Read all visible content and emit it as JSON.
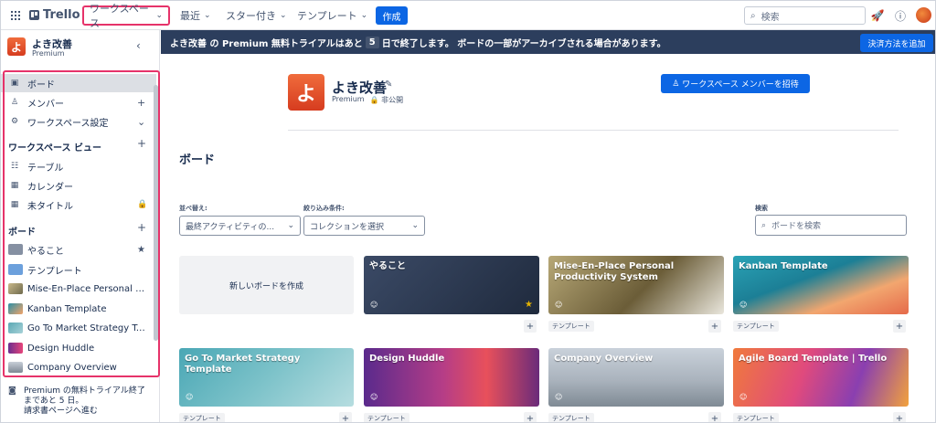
{
  "topbar": {
    "logo_text": "Trello",
    "workspaces_label": "ワークスペース",
    "recent_label": "最近",
    "starred_label": "スター付き",
    "templates_label": "テンプレート",
    "create_label": "作成",
    "search_placeholder": "検索"
  },
  "sidebar": {
    "workspace_name": "よき改善",
    "workspace_initial": "よ",
    "workspace_plan": "Premium",
    "nav": [
      {
        "label": "ボード",
        "icon": "board-icon"
      },
      {
        "label": "メンバー",
        "icon": "person-icon"
      },
      {
        "label": "ワークスペース設定",
        "icon": "gear-icon"
      }
    ],
    "views_heading": "ワークスペース ビュー",
    "views": [
      {
        "label": "テーブル",
        "icon": "table-icon"
      },
      {
        "label": "カレンダー",
        "icon": "calendar-icon"
      },
      {
        "label": "未タイトル",
        "icon": "calendar-icon"
      }
    ],
    "boards_heading": "ボード",
    "boards": [
      {
        "label": "やること",
        "color": "#8590a2",
        "starred": true
      },
      {
        "label": "テンプレート",
        "color": "#6ca0dc",
        "starred": false
      },
      {
        "label": "Mise-En-Place Personal Produ...",
        "color": "#a89c72",
        "starred": false
      },
      {
        "label": "Kanban Template",
        "color": "#3aa6b9",
        "starred": false
      },
      {
        "label": "Go To Market Strategy Templ...",
        "color": "#5ba8b4",
        "starred": false
      },
      {
        "label": "Design Huddle",
        "color": "#a54597",
        "starred": false
      },
      {
        "label": "Company Overview",
        "color": "#9aa3ae",
        "starred": false
      }
    ],
    "premium_note": [
      "Premium の無料トライアル終了",
      "まであと 5 日。",
      "請求書ページへ進む"
    ]
  },
  "banner": {
    "text_before": "よき改善 の Premium 無料トライアルはあと",
    "days": "5",
    "text_after": "日で終了します。 ボードの一部がアーカイブされる場合があります。",
    "pay_button": "決済方法を追加"
  },
  "main": {
    "workspace_title": "よき改善",
    "plan": "Premium",
    "visibility": "非公開",
    "invite_button": "ワークスペース メンバーを招待",
    "boards_heading": "ボード",
    "sort_label": "並べ替え:",
    "sort_value": "最終アクティビティの...",
    "filter_label": "絞り込み条件:",
    "filter_value": "コレクションを選択",
    "search_label": "検索",
    "search_placeholder": "ボードを検索",
    "new_board": "新しいボードを作成",
    "template_tag": "テンプレート",
    "cards": [
      {
        "title": "やること",
        "starred": true,
        "template": false
      },
      {
        "title": "Mise-En-Place Personal Productivity System",
        "starred": false,
        "template": true
      },
      {
        "title": "Kanban Template",
        "starred": false,
        "template": true
      },
      {
        "title": "Go To Market Strategy Template",
        "starred": false,
        "template": true
      },
      {
        "title": "Design Huddle",
        "starred": false,
        "template": true
      },
      {
        "title": "Company Overview",
        "starred": false,
        "template": true
      },
      {
        "title": "Agile Board Template | Trello",
        "starred": false,
        "template": true
      }
    ]
  },
  "colors": {
    "accent": "#0c66e4",
    "highlight": "#e6336a",
    "banner": "#2c3e5d",
    "brand_orange": "#e0512b"
  }
}
